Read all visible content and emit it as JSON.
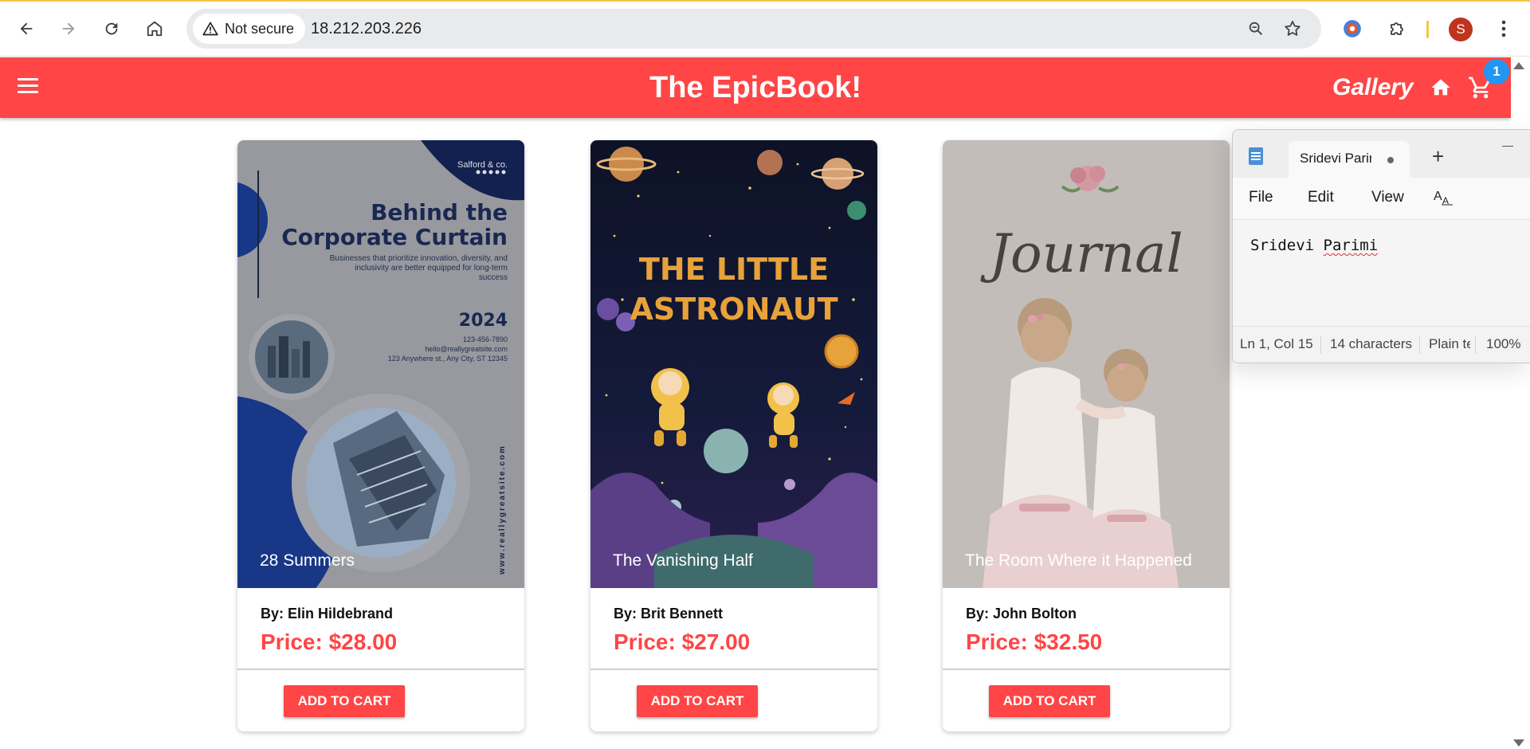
{
  "browser": {
    "security_label": "Not secure",
    "url": "18.212.203.226",
    "profile_initial": "S"
  },
  "site": {
    "title": "The EpicBook!",
    "gallery_link": "Gallery",
    "cart_count": "1"
  },
  "books": [
    {
      "title": "28 Summers",
      "author": "By: Elin Hildebrand",
      "price": "Price: $28.00",
      "button": "ADD TO CART",
      "cover": {
        "publisher": "Salford & co.",
        "heading_line1": "Behind the",
        "heading_line2": "Corporate Curtain",
        "tagline_line1": "Businesses that prioritize innovation, diversity, and",
        "tagline_line2": "inclusivity are better equipped for long-term",
        "tagline_line3": "success",
        "year": "2024",
        "phone": "123-456-7890",
        "email": "hello@reallygreatsite.com",
        "address": "123 Anywhere st., Any City, ST 12345",
        "website": "www.reallygreatsite.com"
      }
    },
    {
      "title": "The Vanishing Half",
      "author": "By: Brit Bennett",
      "price": "Price: $27.00",
      "button": "ADD TO CART",
      "cover": {
        "heading_line1": "THE LITTLE",
        "heading_line2": "ASTRONAUT"
      }
    },
    {
      "title": "The Room Where it Happened",
      "author": "By: John Bolton",
      "price": "Price: $32.50",
      "button": "ADD TO CART",
      "cover": {
        "heading": "Journal"
      }
    }
  ],
  "notepad": {
    "tab_title": "Sridevi Parimi",
    "menu": [
      "File",
      "Edit",
      "View"
    ],
    "content_first": "Sridevi",
    "content_second": "Parimi",
    "status": {
      "position": "Ln 1, Col 15",
      "characters": "14 characters",
      "format": "Plain text",
      "zoom": "100%"
    }
  },
  "colors": {
    "brand": "#ff4545",
    "badge": "#2196f3"
  }
}
